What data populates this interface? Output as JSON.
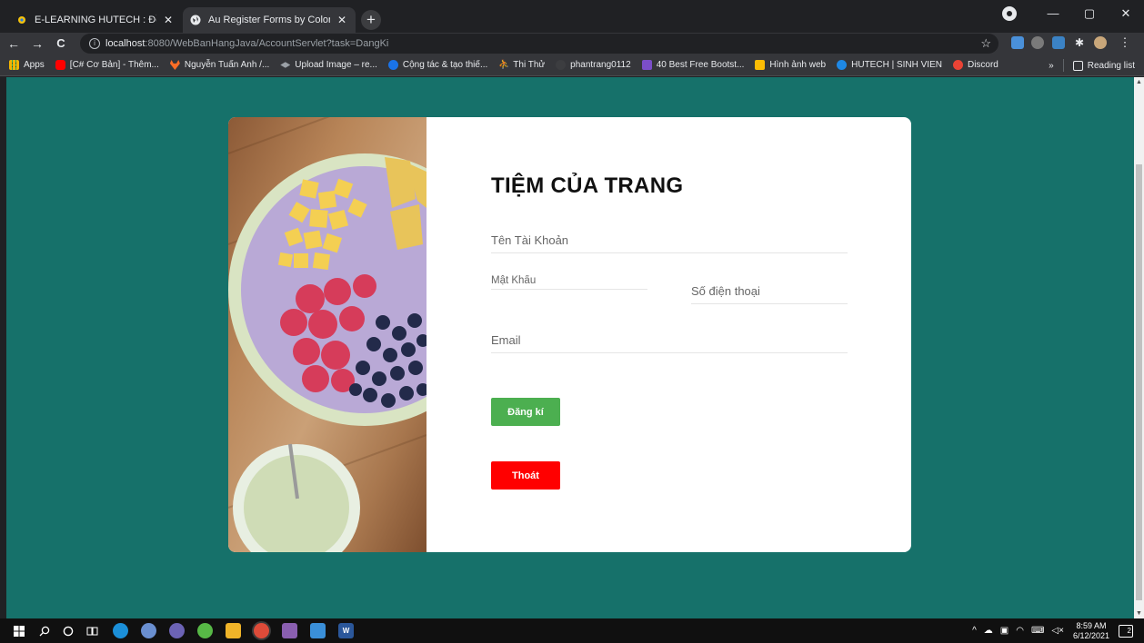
{
  "browser": {
    "tabs": [
      {
        "title": "E-LEARNING HUTECH : Đồ án java",
        "close": "✕",
        "active": false
      },
      {
        "title": "Au Register Forms by Colorlib",
        "close": "✕",
        "active": true
      }
    ],
    "new_tab": "+",
    "window_controls": {
      "minimize": "—",
      "maximize": "▢",
      "close": "✕"
    },
    "address": {
      "host": "localhost",
      "rest": ":8080/WebBanHangJava/AccountServlet?task=DangKi",
      "info": "i"
    },
    "nav": {
      "back": "←",
      "forward": "→",
      "reload": "C"
    },
    "bookmarks": [
      {
        "label": "Apps",
        "color": "#f4b400"
      },
      {
        "label": "[C# Cơ Bản] - Thêm...",
        "color": "#ff0000"
      },
      {
        "label": "Nguyễn Tuấn Anh /...",
        "color": "#fc6d26"
      },
      {
        "label": "Upload Image – re...",
        "color": "#9aa0a6"
      },
      {
        "label": "Cộng tác & tạo thiế...",
        "color": "#1a73e8"
      },
      {
        "label": "Thi Thử",
        "color": "#f9ab00"
      },
      {
        "label": "phantrang0112",
        "color": "#5f6368"
      },
      {
        "label": "40 Best Free Bootst...",
        "color": "#7b4ec9"
      },
      {
        "label": "Hình ảnh web",
        "color": "#fbbc04"
      },
      {
        "label": "HUTECH | SINH VIEN",
        "color": "#1e88e5"
      },
      {
        "label": "Discord",
        "color": "#ea4335"
      }
    ],
    "bookmarks_more": "»",
    "reading_list": "Reading list"
  },
  "page": {
    "brand": "TIỆM CỦA TRANG",
    "fields": {
      "username_placeholder": "Tên Tài Khoản",
      "password_placeholder": "Mật Khẩu",
      "phone_placeholder": "Số điện thoại",
      "email_placeholder": "Email"
    },
    "buttons": {
      "register": "Đăng kí",
      "exit": "Thoát"
    }
  },
  "colors": {
    "page_bg": "#16716a",
    "register_button": "#4caf50",
    "exit_button": "#ff0000"
  },
  "taskbar": {
    "time": "8:59 AM",
    "date": "6/12/2021",
    "notifications": "2"
  }
}
